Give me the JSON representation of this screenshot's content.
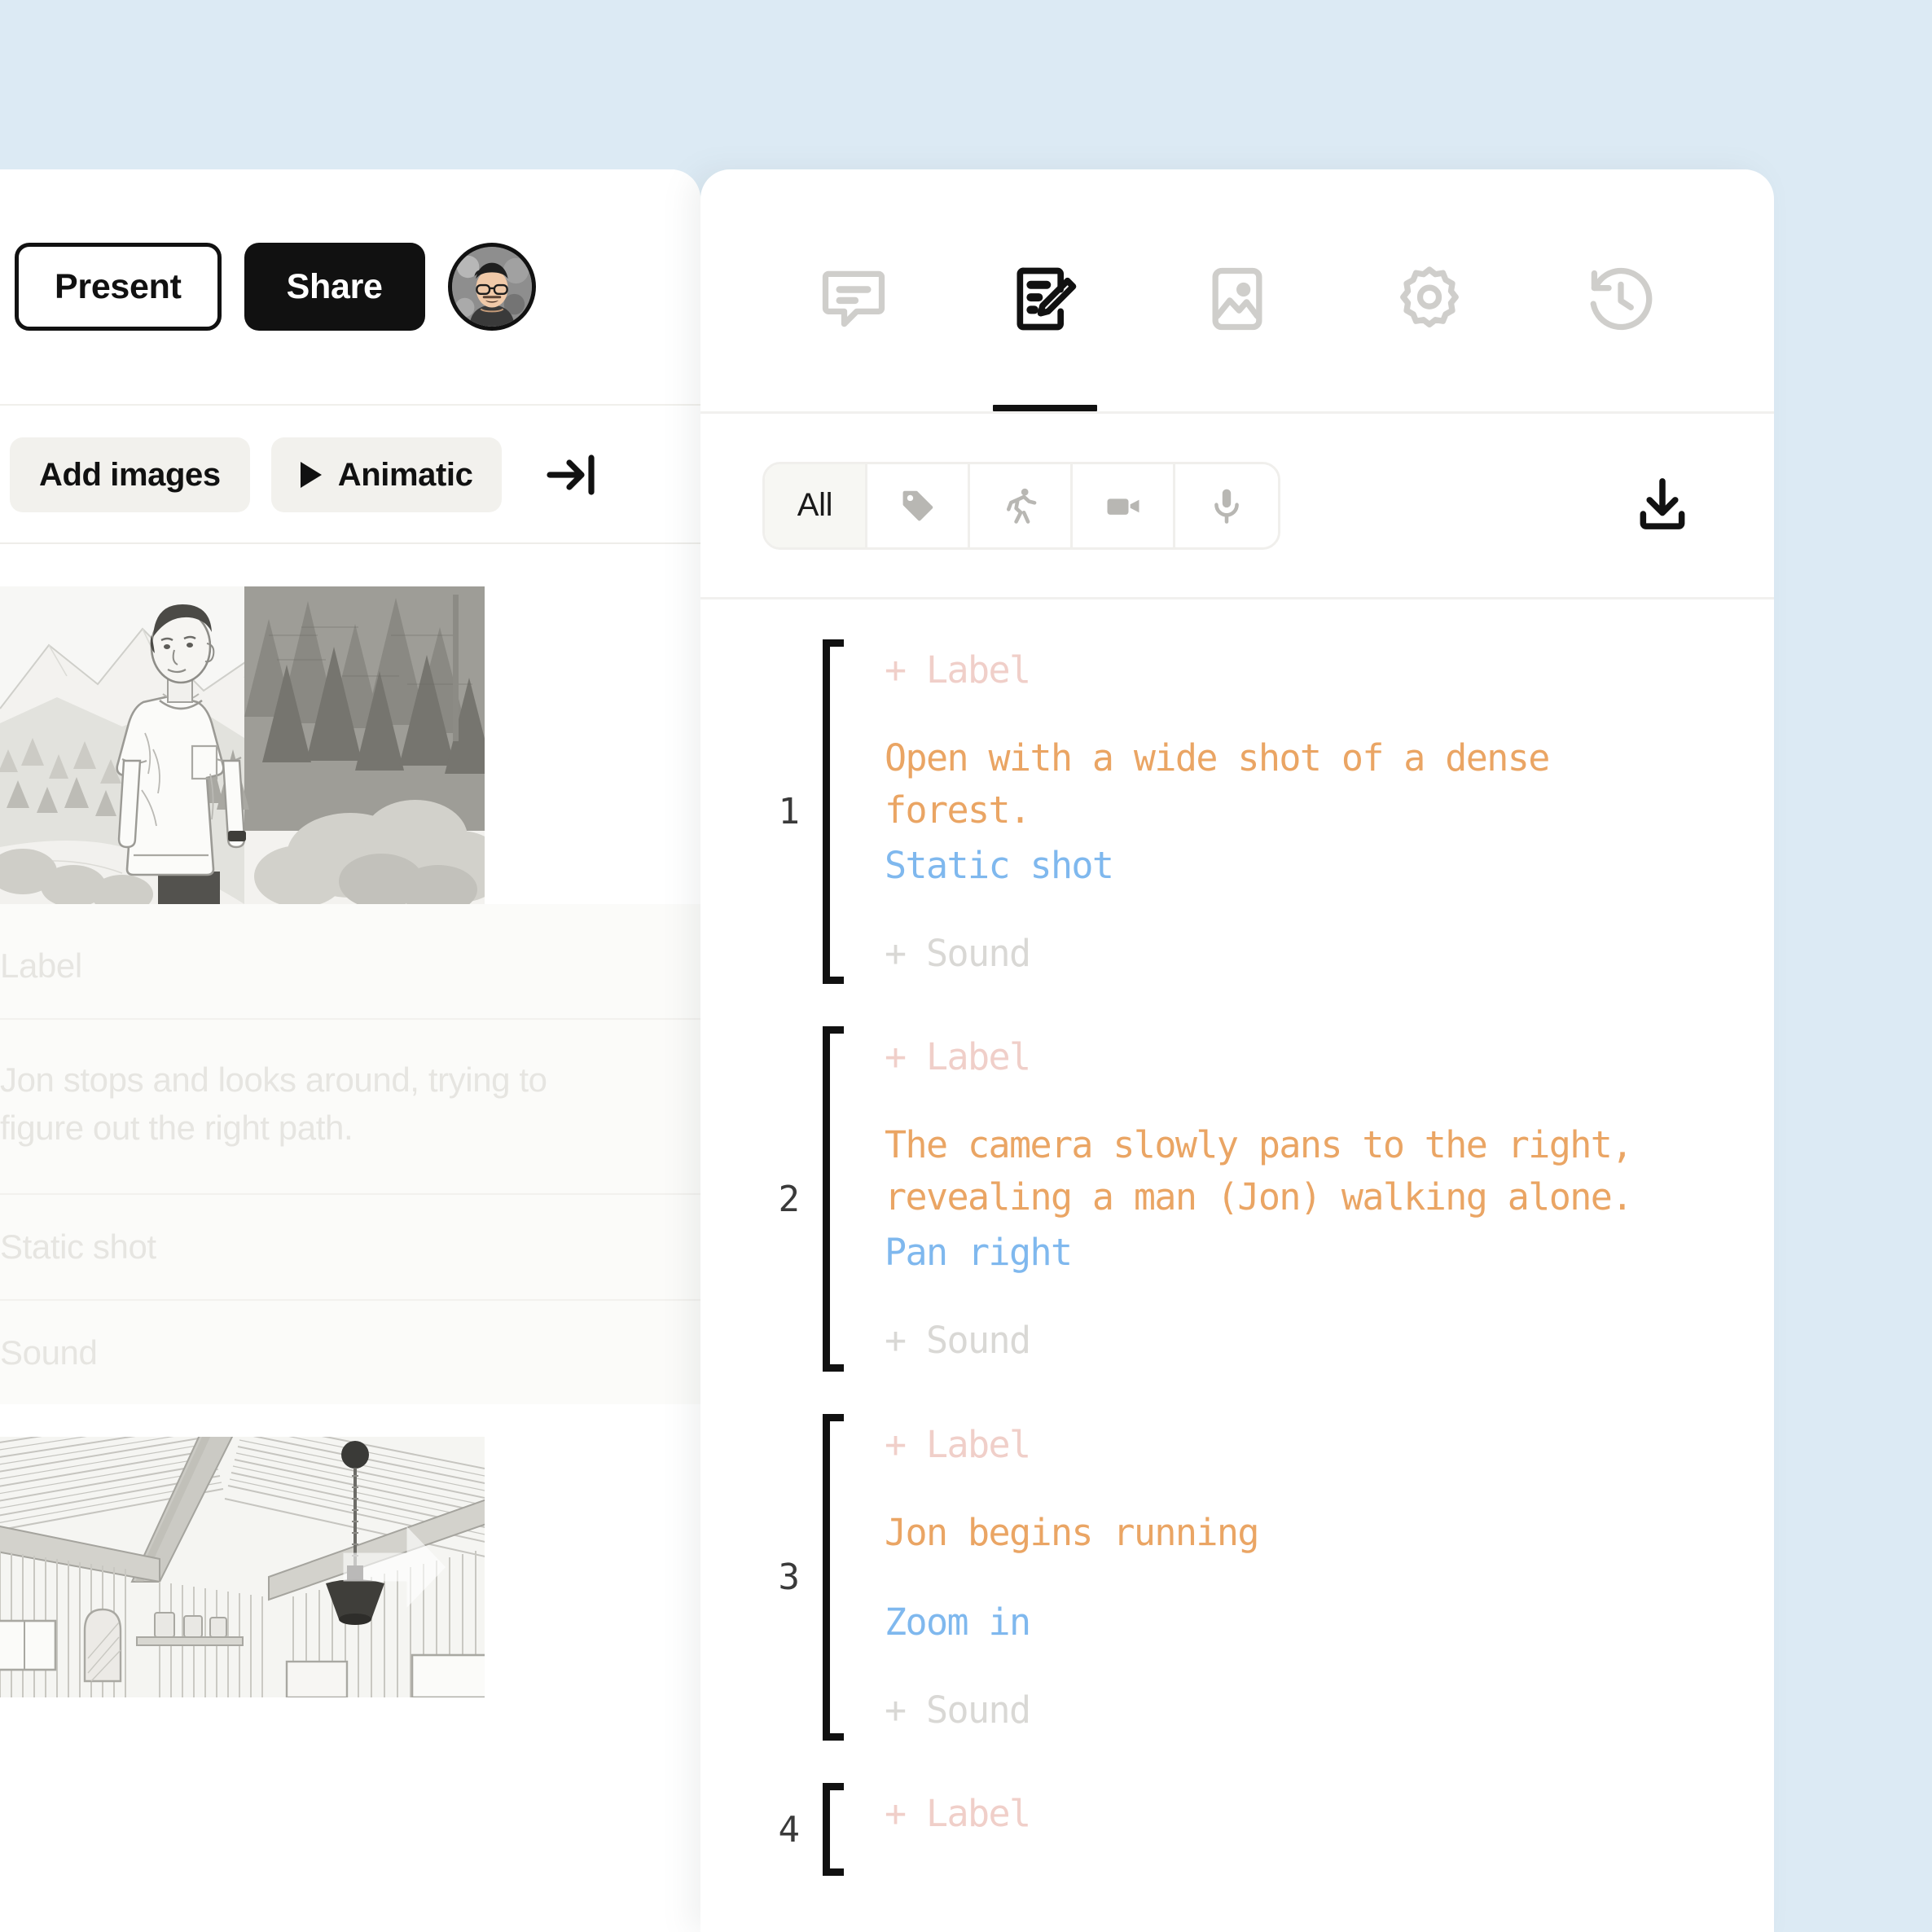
{
  "theme": {
    "background_blue": "#dceaf4",
    "panel_white": "#ffffff",
    "accent_black": "#111111",
    "label_pink": "#f0cfc9",
    "description_orange": "#eaa564",
    "camera_blue": "#7fb8ee",
    "sound_gray": "#d9d8d5",
    "ghost_text": "#e6e5e1"
  },
  "left_panel": {
    "toolbar": {
      "present_label": "Present",
      "share_label": "Share",
      "avatar_name": "user-avatar"
    },
    "subtoolbar": {
      "add_images_label": "Add images",
      "animatic_label": "Animatic",
      "collapse_icon": "arrow-right-to-line-icon"
    },
    "cards": [
      {
        "image_alt": "man standing in forest with mountains",
        "label_field": "Label",
        "description_field": "Jon stops and looks around, trying to figure out the right path.",
        "camera_field": "Static shot",
        "sound_field": "Sound"
      },
      {
        "image_alt": "cabin interior with wooden beams and pendant lamp",
        "next_arrow_icon": "chevron-right-icon"
      }
    ]
  },
  "right_panel": {
    "tabs": [
      {
        "id": "comments",
        "icon": "comment-icon",
        "active": false
      },
      {
        "id": "script",
        "icon": "script-edit-icon",
        "active": true
      },
      {
        "id": "images",
        "icon": "image-icon",
        "active": false
      },
      {
        "id": "settings",
        "icon": "gear-icon",
        "active": false
      },
      {
        "id": "history",
        "icon": "history-clock-icon",
        "active": false
      }
    ],
    "filters": [
      {
        "id": "all",
        "label": "All",
        "icon": null,
        "active": true
      },
      {
        "id": "tag",
        "label": "",
        "icon": "tag-icon",
        "active": false
      },
      {
        "id": "action",
        "label": "",
        "icon": "running-person-icon",
        "active": false
      },
      {
        "id": "camera",
        "label": "",
        "icon": "video-camera-icon",
        "active": false
      },
      {
        "id": "audio",
        "label": "",
        "icon": "microphone-icon",
        "active": false
      }
    ],
    "download_icon": "download-icon",
    "scenes": [
      {
        "number": "1",
        "label": "+ Label",
        "description": "Open with a wide shot of a dense forest.",
        "camera": "Static shot",
        "sound": "+ Sound"
      },
      {
        "number": "2",
        "label": "+ Label",
        "description": "The camera slowly pans to the right, revealing a man (Jon) walking alone.",
        "camera": "Pan right",
        "sound": "+ Sound"
      },
      {
        "number": "3",
        "label": "+ Label",
        "description": "Jon begins running",
        "camera": "Zoom in",
        "sound": "+ Sound"
      },
      {
        "number": "4",
        "label": "+ Label",
        "description": "",
        "camera": "",
        "sound": ""
      }
    ]
  }
}
